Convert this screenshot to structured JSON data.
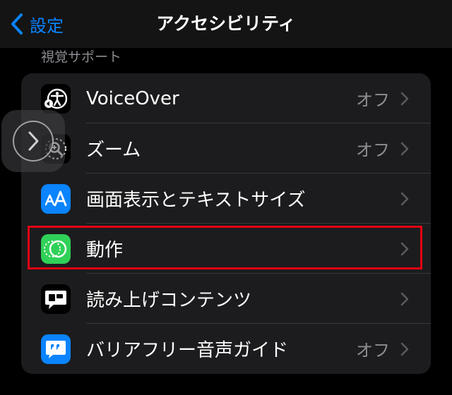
{
  "navbar": {
    "back_label": "設定",
    "title": "アクセシビリティ"
  },
  "section": {
    "header": "視覚サポート"
  },
  "rows": [
    {
      "label": "VoiceOver",
      "value": "オフ",
      "icon": "voiceover-icon",
      "icon_bg": "#000000"
    },
    {
      "label": "ズーム",
      "value": "オフ",
      "icon": "zoom-icon",
      "icon_bg": "#000000"
    },
    {
      "label": "画面表示とテキストサイズ",
      "value": "",
      "icon": "text-size-icon",
      "icon_bg": "#0a84ff"
    },
    {
      "label": "動作",
      "value": "",
      "icon": "motion-icon",
      "icon_bg": "#30d158"
    },
    {
      "label": "読み上げコンテンツ",
      "value": "",
      "icon": "spoken-content-icon",
      "icon_bg": "#000000"
    },
    {
      "label": "バリアフリー音声ガイド",
      "value": "オフ",
      "icon": "audio-descriptions-icon",
      "icon_bg": "#0a84ff"
    }
  ],
  "colors": {
    "accent": "#0a84ff",
    "highlight": "#e60012",
    "secondary_text": "#8d8d93"
  }
}
